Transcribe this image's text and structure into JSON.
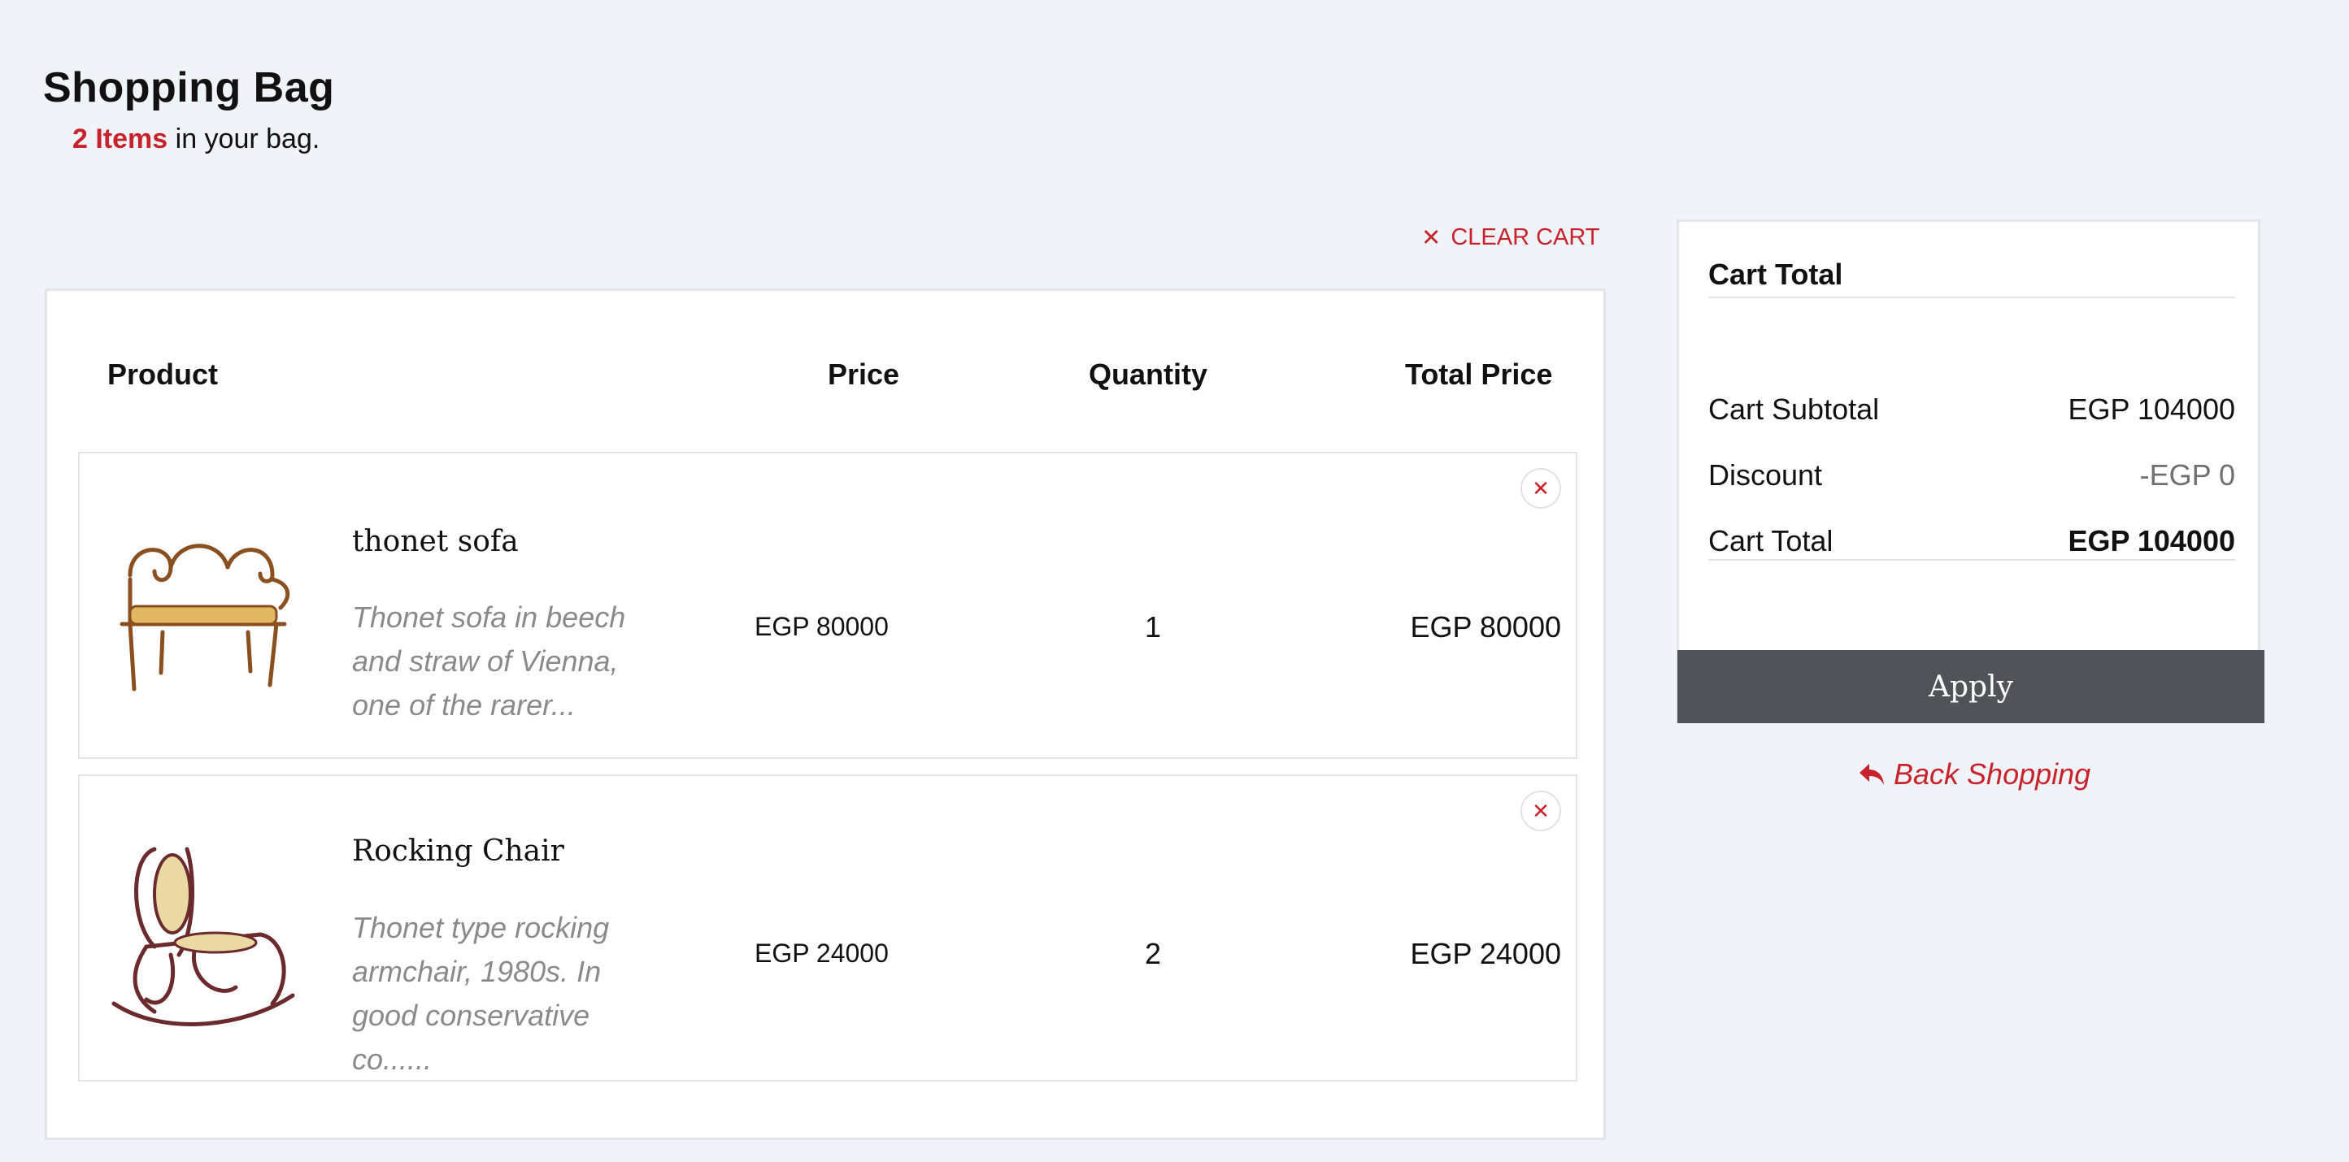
{
  "header": {
    "title": "Shopping Bag",
    "count_text": "2 Items",
    "count_suffix": " in your bag."
  },
  "actions": {
    "clear_cart_label": "CLEAR CART"
  },
  "table": {
    "columns": {
      "product": "Product",
      "price": "Price",
      "quantity": "Quantity",
      "total": "Total Price"
    },
    "items": [
      {
        "name": "thonet sofa",
        "description": "Thonet sofa in beech and straw of Vienna, one of the rarer...",
        "price": "EGP 80000",
        "quantity": "1",
        "total": "EGP 80000",
        "image_icon": "bentwood-sofa-image"
      },
      {
        "name": "Rocking Chair",
        "description": "Thonet type rocking armchair, 1980s. In good conservative co......",
        "price": "EGP 24000",
        "quantity": "2",
        "total": "EGP 24000",
        "image_icon": "rocking-chair-image"
      }
    ]
  },
  "summary": {
    "title": "Cart Total",
    "subtotal_label": "Cart Subtotal",
    "subtotal_value": "EGP 104000",
    "discount_label": "Discount",
    "discount_value": "-EGP 0",
    "total_label": "Cart Total",
    "total_value": "EGP 104000",
    "apply_label": "Apply",
    "back_label": "Back Shopping"
  },
  "colors": {
    "accent": "#c8232c",
    "apply_button": "#525359",
    "background": "#f0f3f8"
  }
}
